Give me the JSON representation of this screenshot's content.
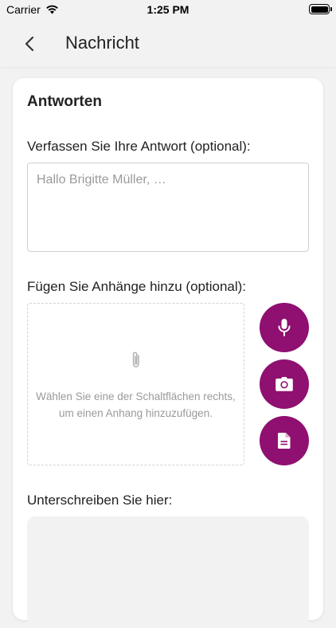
{
  "status_bar": {
    "carrier": "Carrier",
    "time": "1:25 PM"
  },
  "nav": {
    "title": "Nachricht"
  },
  "reply": {
    "section_title": "Antworten",
    "compose_label": "Verfassen Sie Ihre Antwort (optional):",
    "placeholder": "Hallo Brigitte Müller, …",
    "value": ""
  },
  "attachments": {
    "label": "Fügen Sie Anhänge hinzu (optional):",
    "hint": "Wählen Sie eine der Schaltflächen rechts, um einen Anhang hinzuzufügen.",
    "buttons": [
      {
        "icon": "microphone-icon"
      },
      {
        "icon": "camera-icon"
      },
      {
        "icon": "document-icon"
      }
    ]
  },
  "signature": {
    "label": "Unterschreiben Sie hier:"
  },
  "colors": {
    "accent": "#8f1070",
    "background": "#f2f2f2",
    "card": "#ffffff"
  }
}
